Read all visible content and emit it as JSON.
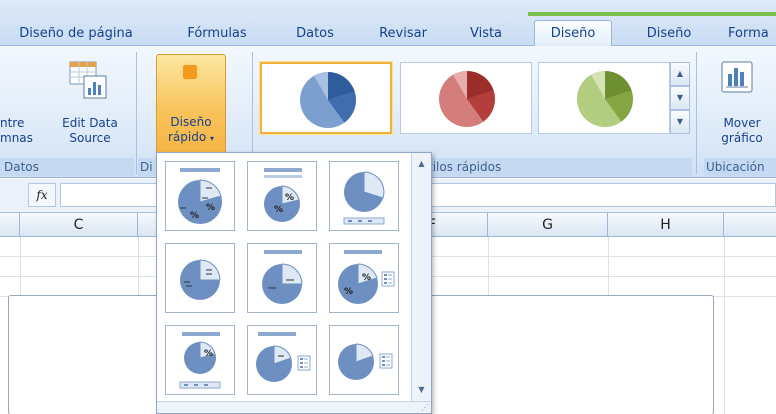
{
  "tabs": [
    {
      "id": "diseno-pagina",
      "label": "Diseño de página",
      "active": false
    },
    {
      "id": "formulas",
      "label": "Fórmulas",
      "active": false
    },
    {
      "id": "datos",
      "label": "Datos",
      "active": false
    },
    {
      "id": "revisar",
      "label": "Revisar",
      "active": false
    },
    {
      "id": "vista",
      "label": "Vista",
      "active": false
    },
    {
      "id": "diseno",
      "label": "Diseño",
      "active": true
    },
    {
      "id": "diseno2",
      "label": "Diseño",
      "active": false
    },
    {
      "id": "formato",
      "label": "Forma",
      "active": false
    }
  ],
  "ribbon": {
    "datos": {
      "switch_label_line1": "ntre",
      "switch_label_line2": "mnas",
      "edit_line1": "Edit Data",
      "edit_line2": "Source",
      "group_label": "Datos"
    },
    "diseno_rapido": {
      "label_line1": "Diseño",
      "label_line2": "rápido",
      "group_label_fragment": "Di"
    },
    "estilos": {
      "group_label": "tilos rápidos"
    },
    "ubicacion": {
      "label_line1": "Mover",
      "label_line2": "gráfico",
      "group_label": "Ubicación"
    }
  },
  "style_colors": {
    "blue": "#4f81bd",
    "red": "#c0504d",
    "green": "#9bbb59",
    "accent_orange": "#f5b343"
  },
  "formula_bar": {
    "fx": "fx"
  },
  "columns": [
    "C",
    "",
    "",
    "F",
    "G",
    "H",
    ""
  ],
  "gallery": {
    "percent": "%"
  }
}
